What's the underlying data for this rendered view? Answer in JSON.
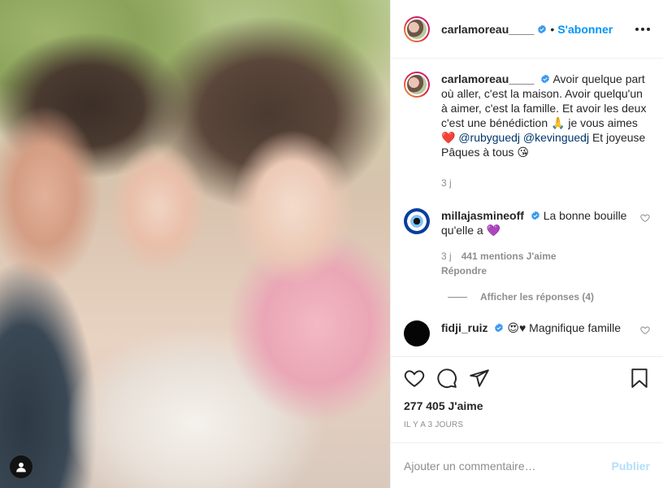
{
  "header": {
    "username": "carlamoreau____",
    "dot": "•",
    "follow_label": "S'abonner"
  },
  "caption": {
    "username": "carlamoreau____",
    "text_1": "Avoir quelque part où aller, c'est la maison. Avoir quelqu'un à aimer, c'est la famille. Et avoir les deux c'est une bénédiction ",
    "emoji_pray": "🙏",
    "text_2": " je vous aimes ",
    "emoji_heart": "❤️",
    "mention_1": "@rubyguedj",
    "mention_2": "@kevinguedj",
    "text_3": " Et joyeuse Pâques à tous ",
    "emoji_kiss": "😘",
    "time": "3 j"
  },
  "comments": [
    {
      "username": "millajasmineoff",
      "text": "La bonne bouille qu'elle a ",
      "emoji": "💜",
      "time": "3 j",
      "likes": "441 mentions J'aime",
      "reply_label": "Répondre"
    },
    {
      "username": "fidji_ruiz",
      "emoji": "😍",
      "emoji2": "♥",
      "text": " Magnifique famille"
    }
  ],
  "view_replies_label": "Afficher les réponses (4)",
  "likes_count": "277 405 J'aime",
  "date_label": "IL Y A 3 JOURS",
  "add_comment": {
    "placeholder": "Ajouter un commentaire…",
    "publish_label": "Publier"
  },
  "colors": {
    "accent": "#0095f6",
    "publish_disabled": "#b2dffc",
    "muted": "#8e8e8e",
    "mention": "#00376b"
  }
}
